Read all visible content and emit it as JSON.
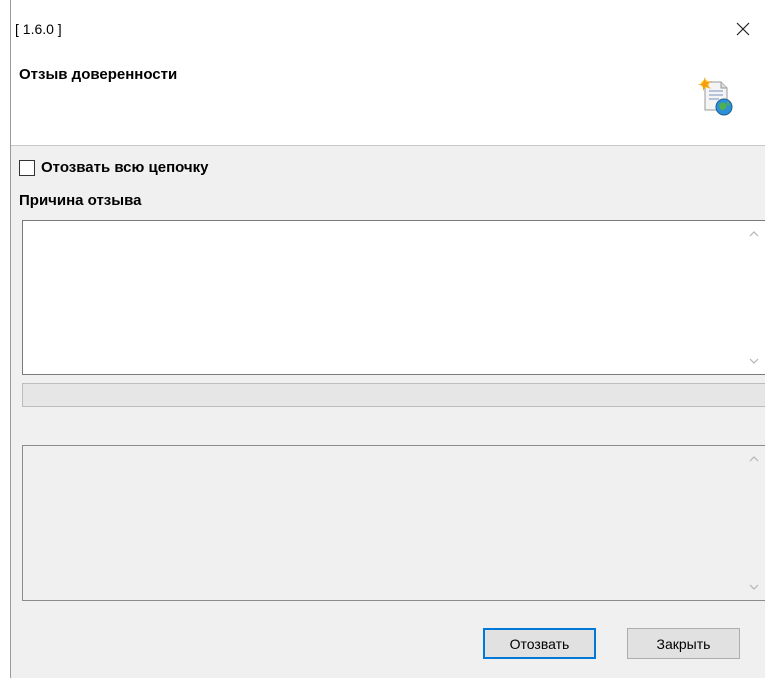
{
  "window": {
    "title": "[ 1.6.0 ]"
  },
  "header": {
    "title": "Отзыв доверенности",
    "icon": "certificate-globe-icon"
  },
  "form": {
    "revoke_chain_label": "Отозвать всю цепочку",
    "revoke_chain_checked": false,
    "reason_label": "Причина отзыва",
    "reason_value": "",
    "log_value": "",
    "progress_fraction": 0
  },
  "buttons": {
    "revoke_label": "Отозвать",
    "close_label": "Закрыть"
  },
  "colors": {
    "accent": "#0078d7",
    "window_bg": "#f0f0f0"
  }
}
